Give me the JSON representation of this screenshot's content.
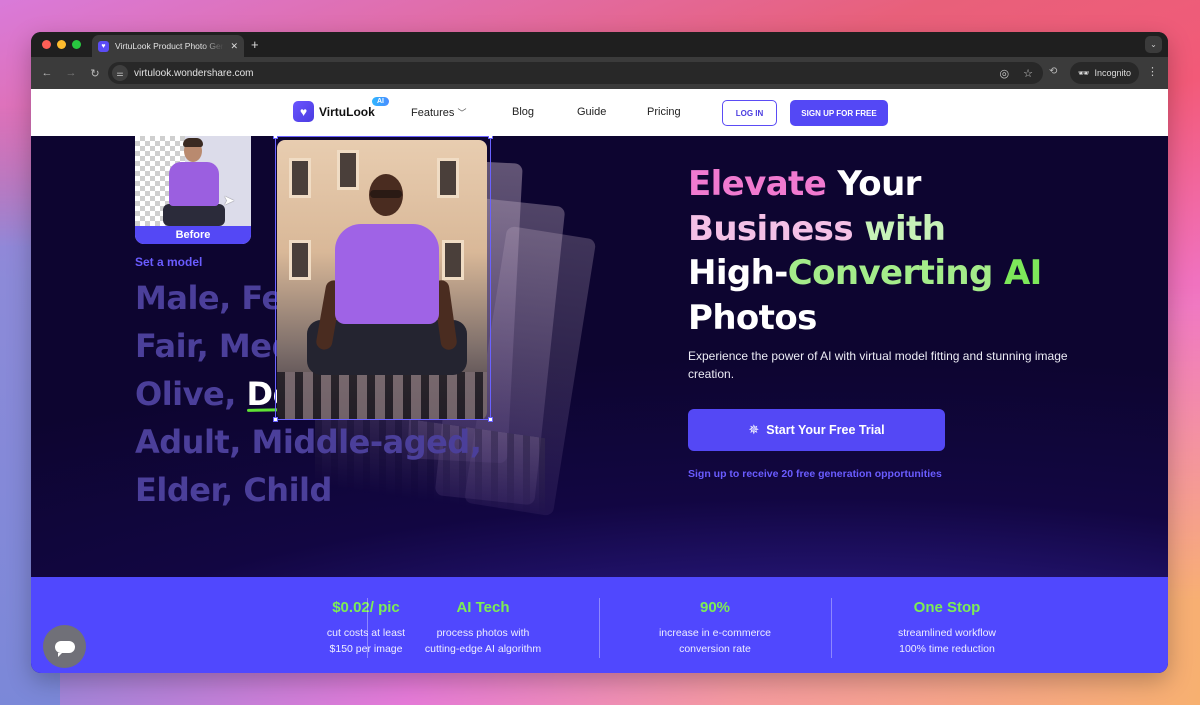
{
  "browser": {
    "tab_title": "VirtuLook Product Photo Generator",
    "url": "virtulook.wondershare.com",
    "incognito_label": "Incognito"
  },
  "nav": {
    "logo_text": "VirtuLook",
    "logo_badge": "AI",
    "links": [
      "Features",
      "Blog",
      "Guide",
      "Pricing"
    ],
    "login_label": "LOG IN",
    "signup_label": "SIGN UP FOR FREE"
  },
  "hero": {
    "before_label": "Before",
    "set_model_label": "Set a model",
    "traits": {
      "line1": "Male, Female,",
      "line2": "Fair, Medium,",
      "line3_prefix": "Olive, ",
      "line3_highlight": "Deep,",
      "line4": "Adult, Middle-aged,",
      "line5": "Elder, Child"
    },
    "headline": {
      "w1": "Elevate",
      "w2": " Your",
      "w3": "Business",
      "w4": " with",
      "w5": "High-",
      "w6": "Converting",
      "w7": " AI",
      "w8": "Photos"
    },
    "subtext": "Experience the power of AI with virtual model fitting and stunning image creation.",
    "cta_label": "Start Your Free Trial",
    "cta_note": "Sign up to receive 20 free generation opportunities"
  },
  "stats": [
    {
      "title": "$0.02/ pic",
      "line1": "cut costs at least",
      "line2": "$150 per image"
    },
    {
      "title": "AI Tech",
      "line1": "process photos with",
      "line2": "cutting-edge AI algorithm"
    },
    {
      "title": "90%",
      "line1": "increase in e-commerce",
      "line2": "conversion rate"
    },
    {
      "title": "One Stop",
      "line1": "streamlined workflow",
      "line2": "100% time reduction"
    }
  ],
  "colors": {
    "brand": "#5448f5",
    "accent_green": "#7ded55",
    "accent_pink": "#f07ad0",
    "hero_bg": "#0d0530"
  }
}
